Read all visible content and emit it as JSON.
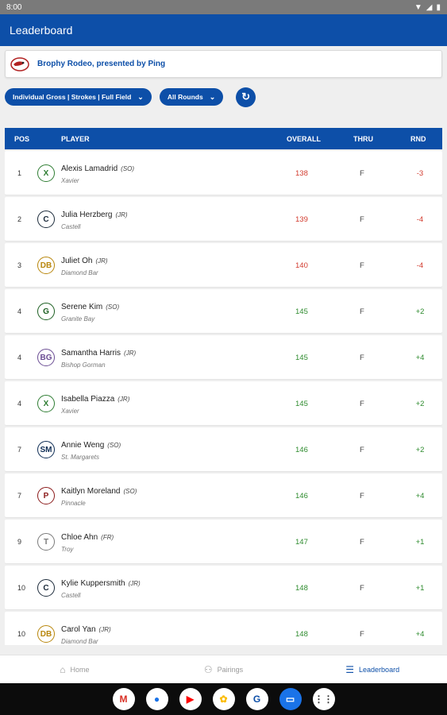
{
  "status": {
    "time": "8:00",
    "wifi_icon": "wifi-icon",
    "signal_icon": "signal-icon",
    "battery_icon": "battery-icon"
  },
  "appbar": {
    "title": "Leaderboard"
  },
  "event": {
    "name": "Brophy Rodeo, presented by Ping",
    "logo_icon": "bronco-logo-icon"
  },
  "filters": {
    "field": "Individual Gross | Strokes | Full Field",
    "rounds": "All Rounds",
    "refresh_icon": "refresh-icon"
  },
  "table": {
    "headers": {
      "pos": "POS",
      "player": "PLAYER",
      "overall": "OVERALL",
      "thru": "THRU",
      "rnd": "RND"
    },
    "rows": [
      {
        "pos": "1",
        "name": "Alexis Lamadrid",
        "grade": "(SO)",
        "school": "Xavier",
        "overall": "138",
        "thru": "F",
        "rnd": "-3",
        "color": "red",
        "logo_color": "#2e7d32",
        "logo_text": "X"
      },
      {
        "pos": "2",
        "name": "Julia Herzberg",
        "grade": "(JR)",
        "school": "Castell",
        "overall": "139",
        "thru": "F",
        "rnd": "-4",
        "color": "red",
        "logo_color": "#1b2a3a",
        "logo_text": "C"
      },
      {
        "pos": "3",
        "name": "Juliet Oh",
        "grade": "(JR)",
        "school": "Diamond Bar",
        "overall": "140",
        "thru": "F",
        "rnd": "-4",
        "color": "red",
        "logo_color": "#b8860b",
        "logo_text": "DB"
      },
      {
        "pos": "4",
        "name": "Serene Kim",
        "grade": "(SO)",
        "school": "Granite Bay",
        "overall": "145",
        "thru": "F",
        "rnd": "+2",
        "color": "green",
        "logo_color": "#1b5e20",
        "logo_text": "G"
      },
      {
        "pos": "4",
        "name": "Samantha Harris",
        "grade": "(JR)",
        "school": "Bishop Gorman",
        "overall": "145",
        "thru": "F",
        "rnd": "+4",
        "color": "green",
        "logo_color": "#6a4c93",
        "logo_text": "BG"
      },
      {
        "pos": "4",
        "name": "Isabella Piazza",
        "grade": "(JR)",
        "school": "Xavier",
        "overall": "145",
        "thru": "F",
        "rnd": "+2",
        "color": "green",
        "logo_color": "#2e7d32",
        "logo_text": "X"
      },
      {
        "pos": "7",
        "name": "Annie Weng",
        "grade": "(SO)",
        "school": "St. Margarets",
        "overall": "146",
        "thru": "F",
        "rnd": "+2",
        "color": "green",
        "logo_color": "#0d2c54",
        "logo_text": "SM"
      },
      {
        "pos": "7",
        "name": "Kaitlyn Moreland",
        "grade": "(SO)",
        "school": "Pinnacle",
        "overall": "146",
        "thru": "F",
        "rnd": "+4",
        "color": "green",
        "logo_color": "#8b1a1a",
        "logo_text": "P"
      },
      {
        "pos": "9",
        "name": "Chloe Ahn",
        "grade": "(FR)",
        "school": "Troy",
        "overall": "147",
        "thru": "F",
        "rnd": "+1",
        "color": "green",
        "logo_color": "#7a7a7a",
        "logo_text": "T"
      },
      {
        "pos": "10",
        "name": "Kylie Kuppersmith",
        "grade": "(JR)",
        "school": "Castell",
        "overall": "148",
        "thru": "F",
        "rnd": "+1",
        "color": "green",
        "logo_color": "#1b2a3a",
        "logo_text": "C"
      },
      {
        "pos": "10",
        "name": "Carol Yan",
        "grade": "(JR)",
        "school": "Diamond Bar",
        "overall": "148",
        "thru": "F",
        "rnd": "+4",
        "color": "green",
        "logo_color": "#b8860b",
        "logo_text": "DB"
      }
    ]
  },
  "bottomnav": {
    "items": [
      {
        "label": "Home",
        "icon": "home-icon"
      },
      {
        "label": "Pairings",
        "icon": "people-icon"
      },
      {
        "label": "Leaderboard",
        "icon": "list-icon"
      }
    ]
  },
  "taskbar": {
    "apps": [
      {
        "name": "gmail-icon",
        "glyph": "M",
        "bg": "#ffffff",
        "fg": "#d93025"
      },
      {
        "name": "chrome-icon",
        "glyph": "●",
        "bg": "#ffffff",
        "fg": "#1a73e8"
      },
      {
        "name": "youtube-icon",
        "glyph": "▶",
        "bg": "#ffffff",
        "fg": "#ff0000"
      },
      {
        "name": "photos-icon",
        "glyph": "✿",
        "bg": "#ffffff",
        "fg": "#fbbc04"
      },
      {
        "name": "golf-app-icon",
        "glyph": "G",
        "bg": "#ffffff",
        "fg": "#0d4fa8"
      },
      {
        "name": "messages-icon",
        "glyph": "▭",
        "bg": "#1a73e8",
        "fg": "#ffffff"
      },
      {
        "name": "apps-icon",
        "glyph": "⋮⋮",
        "bg": "#ffffff",
        "fg": "#333333"
      }
    ]
  }
}
